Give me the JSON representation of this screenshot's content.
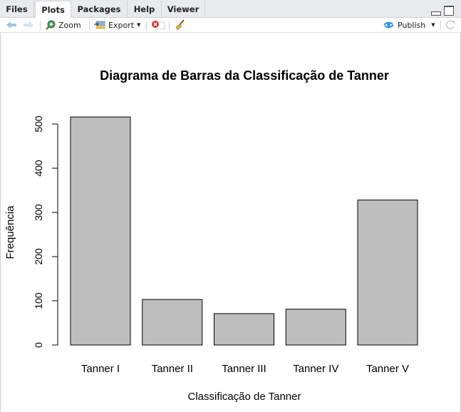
{
  "tabs": [
    {
      "label": "Files",
      "active": false
    },
    {
      "label": "Plots",
      "active": true
    },
    {
      "label": "Packages",
      "active": false
    },
    {
      "label": "Help",
      "active": false
    },
    {
      "label": "Viewer",
      "active": false
    }
  ],
  "toolbar": {
    "zoom_label": "Zoom",
    "export_label": "Export",
    "publish_label": "Publish"
  },
  "chart_data": {
    "type": "bar",
    "title": "Diagrama de Barras da Classificação de Tanner",
    "xlabel": "Classificação de Tanner",
    "ylabel": "Frequência",
    "categories": [
      "Tanner I",
      "Tanner II",
      "Tanner III",
      "Tanner IV",
      "Tanner V"
    ],
    "values": [
      516,
      103,
      71,
      81,
      328
    ],
    "yticks": [
      0,
      100,
      200,
      300,
      400,
      500
    ],
    "ylim": [
      0,
      500
    ],
    "grid": false,
    "bar_color": "#bebebe",
    "bar_border": "#000000"
  }
}
